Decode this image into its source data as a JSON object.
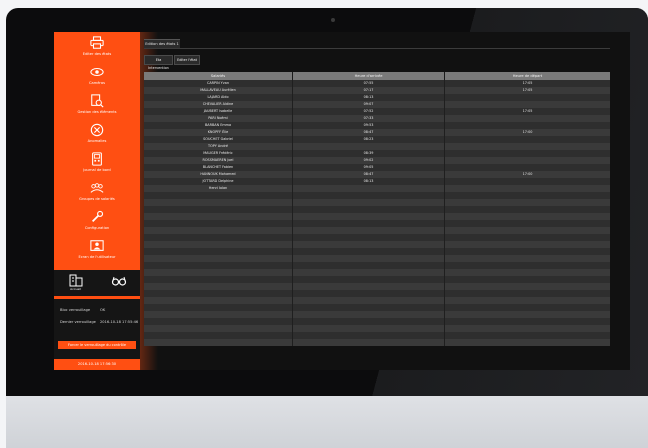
{
  "nav": [
    {
      "label": "Editer des états",
      "icon": "printer-icon"
    },
    {
      "label": "Caméras",
      "icon": "eye-icon"
    },
    {
      "label": "Gestion des éléments",
      "icon": "document-search-icon"
    },
    {
      "label": "Anomalies",
      "icon": "cancel-circle-icon"
    },
    {
      "label": "Journal de bord",
      "icon": "phone-log-icon"
    },
    {
      "label": "Groupes de salariés",
      "icon": "group-icon"
    },
    {
      "label": "Configuration",
      "icon": "wrench-icon"
    },
    {
      "label": "Ecran de l'utilisateur",
      "icon": "user-screen-icon"
    }
  ],
  "side_icons": [
    {
      "label": "Accueil",
      "icon": "building-icon"
    },
    {
      "label": "",
      "icon": "glasses-icon"
    }
  ],
  "status": {
    "label1": "Bloc verrouillage",
    "value1": "OK",
    "label2": "Dernier verrouillage",
    "value2": "2016-10-18 17:55:46"
  },
  "reset_label": "Forcer le verrouillage du contrôle",
  "clock": "2016-10-18 17:56:30",
  "tab_label": "Edition des états 1",
  "buttons": [
    "Eta Intervention",
    "Editer l'état"
  ],
  "table": {
    "headers": [
      "Salariés",
      "Heure d'arrivée",
      "Heure de départ"
    ],
    "rows": [
      [
        "CARPIN Yvan",
        "07:55",
        "17:05"
      ],
      [
        "MALLAVEAU Aurélien",
        "07:17",
        "17:05"
      ],
      [
        "LAJARD Aldo",
        "08:13",
        ""
      ],
      [
        "CHEVALIER Aldine",
        "09:07",
        ""
      ],
      [
        "JAUBERT Isabelle",
        "07:52",
        "17:05"
      ],
      [
        "PARI Noémi",
        "07:33",
        ""
      ],
      [
        "BARBAN Emma",
        "09:53",
        ""
      ],
      [
        "KNOPFF Élie",
        "08:47",
        "17:00"
      ],
      [
        "SOUCHET Gabriel",
        "08:23",
        ""
      ],
      [
        "TOPY André",
        "",
        ""
      ],
      [
        "MAUGER Frédéric",
        "08:39",
        ""
      ],
      [
        "ROSSMAEREN Joel",
        "09:02",
        ""
      ],
      [
        "BLANCHET Fabien",
        "09:05",
        ""
      ],
      [
        "HANNOUK Mohamed",
        "08:47",
        "17:00"
      ],
      [
        "JOTTARD Delphine",
        "08:13",
        ""
      ],
      [
        "Henri Iolan",
        "",
        ""
      ],
      [
        "",
        "",
        ""
      ],
      [
        "",
        "",
        ""
      ],
      [
        "",
        "",
        ""
      ],
      [
        "",
        "",
        ""
      ],
      [
        "",
        "",
        ""
      ],
      [
        "",
        "",
        ""
      ],
      [
        "",
        "",
        ""
      ],
      [
        "",
        "",
        ""
      ],
      [
        "",
        "",
        ""
      ],
      [
        "",
        "",
        ""
      ],
      [
        "",
        "",
        ""
      ],
      [
        "",
        "",
        ""
      ],
      [
        "",
        "",
        ""
      ],
      [
        "",
        "",
        ""
      ],
      [
        "",
        "",
        ""
      ],
      [
        "",
        "",
        ""
      ],
      [
        "",
        "",
        ""
      ],
      [
        "",
        "",
        ""
      ],
      [
        "",
        "",
        ""
      ],
      [
        "",
        "",
        ""
      ],
      [
        "",
        "",
        ""
      ],
      [
        "",
        "",
        ""
      ]
    ]
  },
  "colors": {
    "accent": "#ff4f12",
    "header": "#7a7a7a",
    "row_dark": "#2e2e2e",
    "row_light": "#3a3a3a"
  }
}
